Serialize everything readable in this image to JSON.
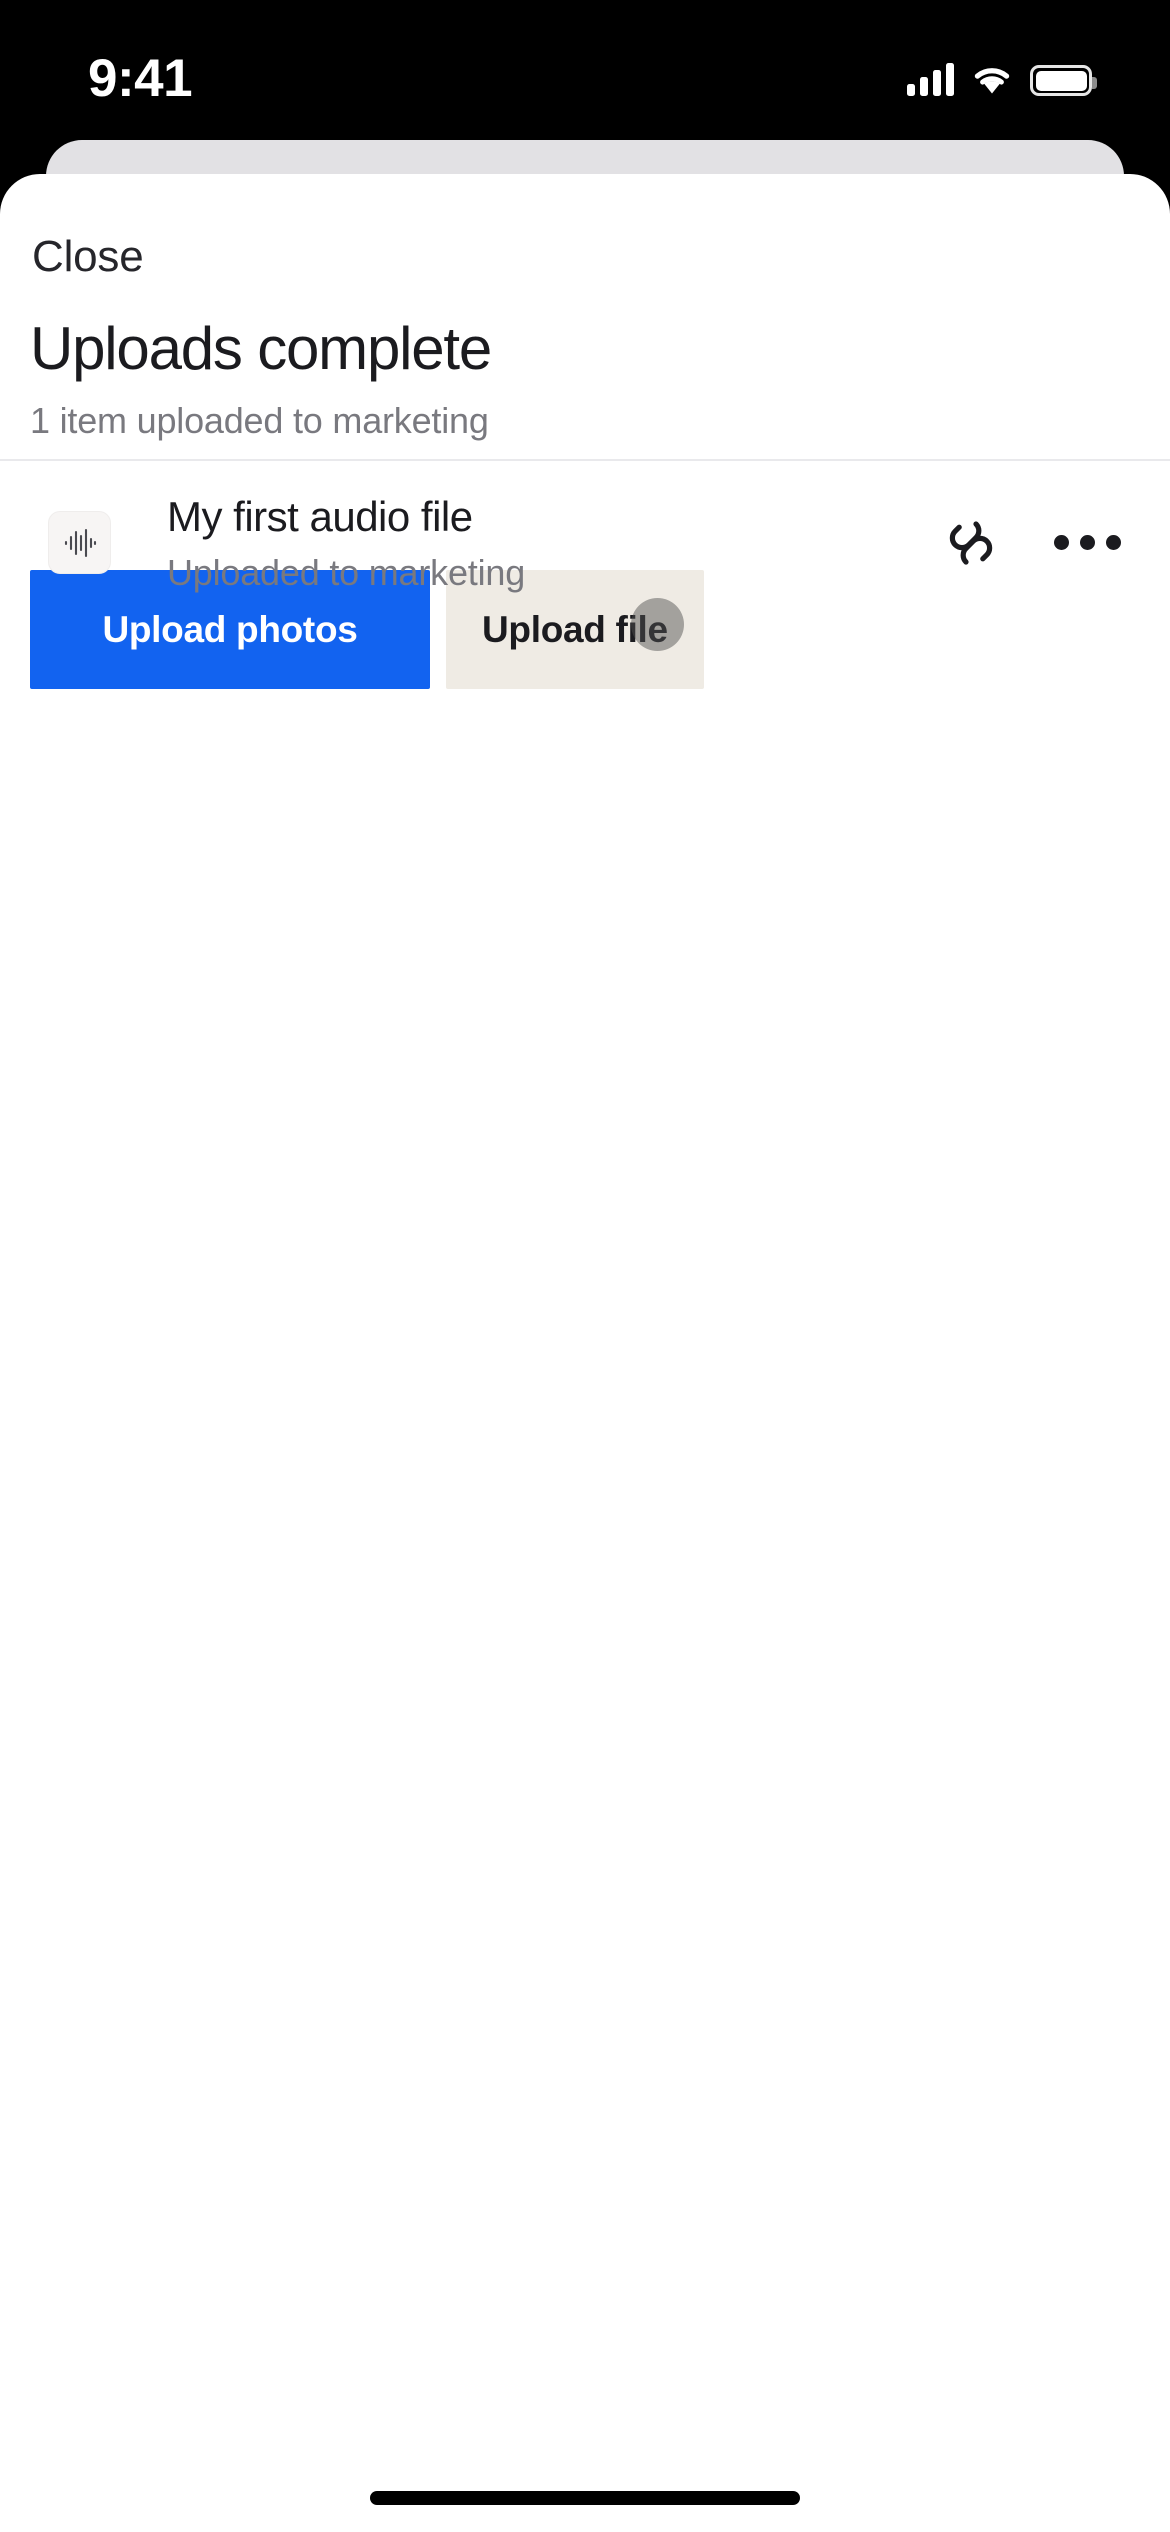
{
  "status_bar": {
    "time": "9:41",
    "cellular_icon": "cellular-signal-icon",
    "wifi_icon": "wifi-icon",
    "battery_icon": "battery-icon"
  },
  "sheet": {
    "close_label": "Close",
    "title": "Uploads complete",
    "subtitle": "1 item uploaded to marketing"
  },
  "actions": {
    "primary_label": "Upload photos",
    "secondary_label": "Upload file",
    "primary_color": "#1263f0",
    "primary_text_color": "#ffffff",
    "secondary_color": "#efebe4",
    "secondary_text_color": "#1b1b1f",
    "touch_indicator_color": "rgba(80,80,80,0.48)"
  },
  "files": [
    {
      "thumb_icon": "audio-waveform-icon",
      "name": "My first audio file",
      "status": "Uploaded to marketing",
      "link_icon": "link-chain-icon",
      "more_icon": "more-horizontal-icon"
    }
  ],
  "home_indicator": "home-indicator"
}
